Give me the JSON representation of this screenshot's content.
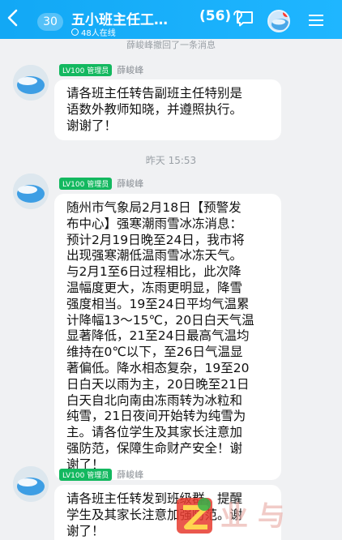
{
  "header": {
    "back_count": "30",
    "title": "五小班主任工…",
    "member_count": "(56)",
    "online": "48人在线"
  },
  "system_notice": "薛峻峰撤回了一条消息",
  "time_separator": "昨天 15:53",
  "messages": [
    {
      "level_tag": "LV100 管理员",
      "sender": "薛峻峰",
      "lines": [
        "请各班主任转告副班主任特别是",
        "语数外教师知晓，并遵照执行。",
        "谢谢了！"
      ]
    },
    {
      "level_tag": "LV100 管理员",
      "sender": "薛峻峰",
      "lines": [
        "随州市气象局2月18日【预警发",
        "布中心】强寒潮雨雪冰冻消息：",
        "预计2月19日晚至24日，我市将",
        "出现强寒潮低温雨雪冰冻天气。",
        "与2月1至6日过程相比，此次降",
        "温幅度更大，冻雨更明显，降雪",
        "强度相当。19至24日平均气温累",
        "计降幅13～15℃，20日白天气温",
        "显著降低，21至24日最高气温均",
        "维持在0℃以下，至26日气温显",
        "著偏低。降水相态复杂，19至20",
        "日白天以雨为主，20日晚至21日",
        "白天自北向南由冻雨转为冰粒和",
        "纯雪，21日夜间开始转为纯雪为",
        "主。请各位学生及其家长注意加",
        "强防范，保障生命财产安全！谢",
        "谢了！"
      ]
    },
    {
      "level_tag": "LV100 管理员",
      "sender": "薛峻峰",
      "lines": [
        "请各班主任转发到班级群，提醒",
        "学生及其家长注意加强防范。谢",
        "谢了！"
      ]
    }
  ],
  "colors": {
    "header_blue": "#1fb6ff",
    "admin_tag_green": "#13b85f",
    "background": "#f0f1f3"
  }
}
